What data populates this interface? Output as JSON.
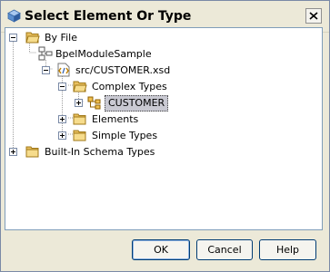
{
  "window": {
    "title": "Select Element Or Type"
  },
  "tree": {
    "by_file": "By File",
    "module": "BpelModuleSample",
    "file": "src/CUSTOMER.xsd",
    "complex_types": "Complex Types",
    "customer": "CUSTOMER",
    "elements": "Elements",
    "simple_types": "Simple Types",
    "builtin": "Built-In Schema Types"
  },
  "buttons": {
    "ok": "OK",
    "cancel": "Cancel",
    "help": "Help"
  }
}
